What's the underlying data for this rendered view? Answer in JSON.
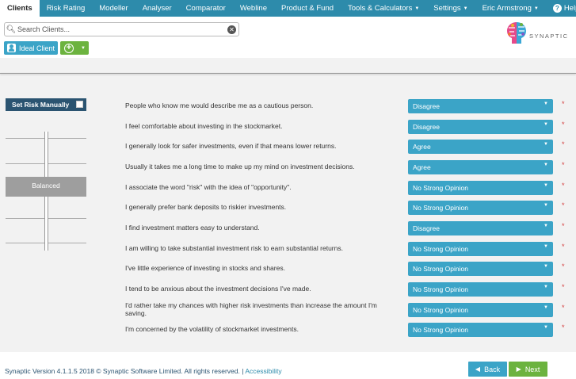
{
  "nav": {
    "tabs": [
      {
        "label": "Clients",
        "active": true
      },
      {
        "label": "Risk Rating"
      },
      {
        "label": "Modeller"
      },
      {
        "label": "Analyser"
      },
      {
        "label": "Comparator"
      },
      {
        "label": "Webline"
      },
      {
        "label": "Product & Fund"
      },
      {
        "label": "Tools & Calculators",
        "dropdown": true
      }
    ],
    "settings": "Settings",
    "user": "Eric Armstrong",
    "help": "Help",
    "bg_color": "#2d8bab"
  },
  "header": {
    "search_placeholder": "Search Clients...",
    "ideal_client": "Ideal Client",
    "logo_text": "SYNAPTIC"
  },
  "left_panel": {
    "set_risk_label": "Set Risk Manually",
    "set_risk_checked": false,
    "risk_band": "Balanced"
  },
  "questions": [
    {
      "text": "People who know me would describe me as a cautious person.",
      "answer": "Disagree"
    },
    {
      "text": "I feel comfortable about investing in the stockmarket.",
      "answer": "Disagree"
    },
    {
      "text": "I generally look for safer investments, even if that means lower returns.",
      "answer": "Agree"
    },
    {
      "text": "Usually it takes me a long time to make up my mind on investment decisions.",
      "answer": "Agree"
    },
    {
      "text": "I associate the word \"risk\" with the idea of \"opportunity\".",
      "answer": "No Strong Opinion"
    },
    {
      "text": "I generally prefer bank deposits to riskier investments.",
      "answer": "No Strong Opinion"
    },
    {
      "text": "I find investment matters easy to understand.",
      "answer": "Disagree"
    },
    {
      "text": "I am willing to take substantial investment risk to earn substantial returns.",
      "answer": "No Strong Opinion"
    },
    {
      "text": "I've little experience of investing in stocks and shares.",
      "answer": "No Strong Opinion"
    },
    {
      "text": "I tend to be anxious about the investment decisions I've made.",
      "answer": "No Strong Opinion"
    },
    {
      "text": "I'd rather take my chances with higher risk investments than increase the amount I'm saving.",
      "answer": "No Strong Opinion"
    },
    {
      "text": "I'm concerned by the volatility of stockmarket investments.",
      "answer": "No Strong Opinion"
    }
  ],
  "required_mark": "*",
  "footer": {
    "version_text": "Synaptic Version 4.1.1.5   2018 © Synaptic Software Limited. All rights reserved.  | ",
    "accessibility": "Accessibility",
    "back": "Back",
    "next": "Next"
  },
  "colors": {
    "accent": "#3ba4c7",
    "green": "#6cb33f",
    "dark_blue": "#2b5471",
    "required": "#d43b3b"
  }
}
